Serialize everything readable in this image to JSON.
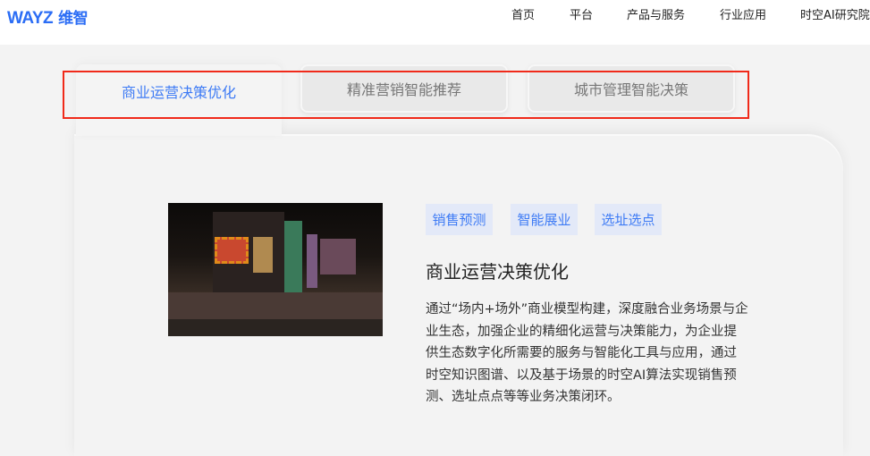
{
  "header": {
    "logo_text": "WAYZ",
    "logo_cn": "维智",
    "nav": [
      "首页",
      "平台",
      "产品与服务",
      "行业应用",
      "时空AI研究院"
    ]
  },
  "tabs": [
    {
      "label": "商业运营决策优化",
      "active": true
    },
    {
      "label": "精准营销智能推荐",
      "active": false
    },
    {
      "label": "城市管理智能决策",
      "active": false
    }
  ],
  "content": {
    "tags": [
      "销售预测",
      "智能展业",
      "选址选点"
    ],
    "title": "商业运营决策优化",
    "description": "通过“场内+场外”商业模型构建，深度融合业务场景与企业生态，加强企业的精细化运营与决策能力，为企业提供生态数字化所需要的服务与智能化工具与应用，通过时空知识图谱、以及基于场景的时空AI算法实现销售预测、选址点点等等业务决策闭环。"
  },
  "colors": {
    "accent": "#3e7bf5",
    "highlight": "#f02a1a"
  }
}
